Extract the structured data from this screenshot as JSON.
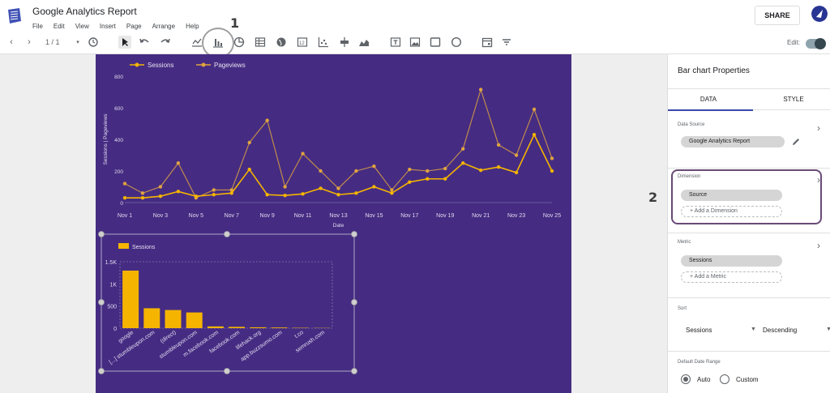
{
  "header": {
    "title": "Google Analytics Report",
    "menu": [
      "File",
      "Edit",
      "View",
      "Insert",
      "Page",
      "Arrange",
      "Help"
    ],
    "share_label": "SHARE"
  },
  "toolbar": {
    "page_indicator": "1 / 1",
    "edit_label": "Edit:",
    "edit_enabled": true
  },
  "annotations": {
    "step1": "1",
    "step2": "2"
  },
  "line_chart": {
    "legend": [
      "Sessions",
      "Pageviews"
    ],
    "ylabel": "Sessions | Pageviews",
    "xlabel": "Date",
    "chart_data": {
      "type": "line",
      "x": [
        "Nov 1",
        "Nov 2",
        "Nov 3",
        "Nov 4",
        "Nov 5",
        "Nov 6",
        "Nov 7",
        "Nov 8",
        "Nov 9",
        "Nov 10",
        "Nov 11",
        "Nov 12",
        "Nov 13",
        "Nov 14",
        "Nov 15",
        "Nov 16",
        "Nov 17",
        "Nov 18",
        "Nov 19",
        "Nov 20",
        "Nov 21",
        "Nov 22",
        "Nov 23",
        "Nov 24",
        "Nov 25"
      ],
      "x_tick_labels": [
        "Nov 1",
        "Nov 3",
        "Nov 5",
        "Nov 7",
        "Nov 9",
        "Nov 11",
        "Nov 13",
        "Nov 15",
        "Nov 17",
        "Nov 19",
        "Nov 21",
        "Nov 23",
        "Nov 25"
      ],
      "y_ticks": [
        "0",
        "200",
        "400",
        "600",
        "800"
      ],
      "ylim": [
        0,
        800
      ],
      "series": [
        {
          "name": "Sessions",
          "color": "#f5b400",
          "values": [
            30,
            30,
            40,
            70,
            40,
            50,
            60,
            210,
            50,
            45,
            55,
            90,
            50,
            60,
            100,
            60,
            130,
            150,
            150,
            250,
            205,
            225,
            190,
            430,
            200
          ]
        },
        {
          "name": "Pageviews",
          "color": "#e0a340",
          "values": [
            120,
            60,
            100,
            250,
            30,
            80,
            80,
            380,
            520,
            100,
            310,
            200,
            90,
            200,
            230,
            80,
            210,
            200,
            215,
            340,
            715,
            365,
            300,
            590,
            280
          ]
        }
      ]
    }
  },
  "bar_chart": {
    "legend": "Sessions",
    "chart_data": {
      "type": "bar",
      "categories": [
        "google",
        "[...] stumbleupon.com",
        "(direct)",
        "stumbleupon.com",
        "m.facebook.com",
        "facebook.com",
        "lifehack.org",
        "app.buzzsumo.com",
        "t.co",
        "semrush.com"
      ],
      "series": [
        {
          "name": "Sessions",
          "color": "#f5b400",
          "values": [
            1300,
            450,
            410,
            355,
            40,
            30,
            20,
            15,
            8,
            5
          ]
        }
      ],
      "y_ticks": [
        "0",
        "500",
        "1K",
        "1.5K"
      ],
      "ylim": [
        0,
        1500
      ]
    }
  },
  "panel": {
    "title": "Bar chart Properties",
    "tabs": [
      "DATA",
      "STYLE"
    ],
    "data_source_label": "Data Source",
    "data_source": "Google Analytics Report",
    "dimension_label": "Dimension",
    "dimension": "Source",
    "add_dimension": "+ Add a Dimension",
    "metric_label": "Metric",
    "metric": "Sessions",
    "add_metric": "+ Add a Metric",
    "sort_label": "Sort",
    "sort_field": "Sessions",
    "sort_order": "Descending",
    "date_range_label": "Default Date Range",
    "date_auto": "Auto",
    "date_custom": "Custom"
  }
}
